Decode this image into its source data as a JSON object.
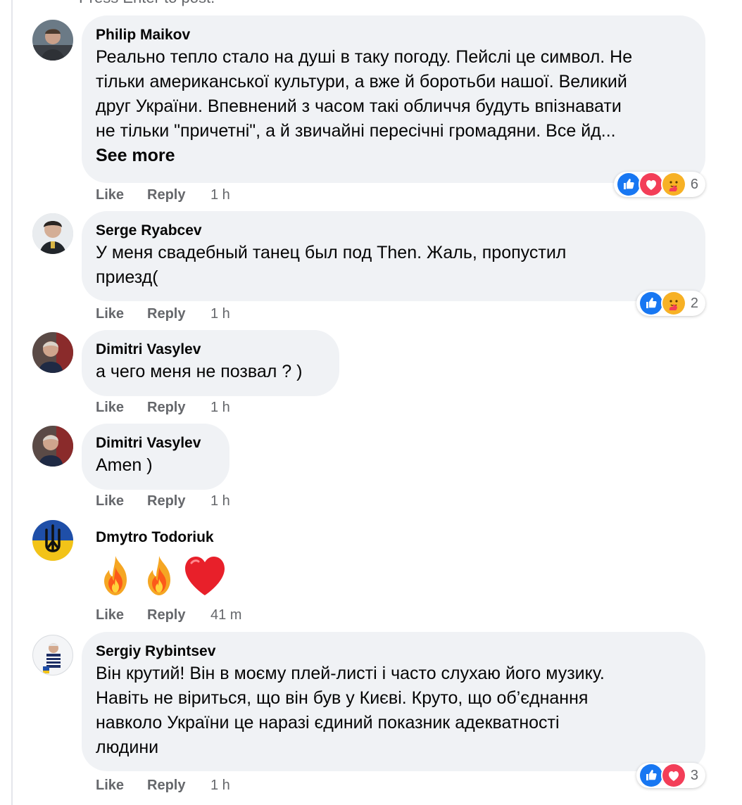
{
  "top_hint": "Press Enter to post.",
  "actions": {
    "like": "Like",
    "reply": "Reply"
  },
  "colors": {
    "like_blue": "#1877f2",
    "love_red": "#f33e58",
    "care_yellow": "#f7b125",
    "bubble_bg": "#f0f2f5",
    "meta_gray": "#65676b"
  },
  "comments": [
    {
      "author": "Philip Maikov",
      "text": "Реально тепло стало на душі в таку погоду. Пейслі це символ. Не\nтільки американської культури, а вже й боротьби нашої. Великий\nдруг України. Впевнений з часом такі обличчя будуть впізнавати\nне тільки \"причетні\", а й звичайні пересічні громадяни. Все йд...",
      "see_more": "See more",
      "time": "1 h",
      "reactions": [
        "like-icon",
        "love-icon",
        "care-icon"
      ],
      "reaction_count": "6"
    },
    {
      "author": "Serge Ryabcev",
      "text": "У меня свадебный танец был под Then. Жаль, пропустил\nприезд(",
      "time": "1 h",
      "reactions": [
        "like-icon",
        "care-icon"
      ],
      "reaction_count": "2"
    },
    {
      "author": "Dimitri Vasylev",
      "text": "а чего меня не позвал ? )",
      "time": "1 h"
    },
    {
      "author": "Dimitri Vasylev",
      "text": "Amen )",
      "time": "1 h"
    },
    {
      "author": "Dmytro Todoriuk",
      "emojis": [
        "fire-emoji",
        "fire-emoji",
        "heart-emoji"
      ],
      "time": "41 m"
    },
    {
      "author": "Sergiy Rybintsev",
      "text": "Він крутий! Він в моєму плей-листі і часто слухаю його музику.\nНавіть не віриться, що він був у Києві. Круто, що об’єднання\nнавколо України це наразі єдиний показник адекватності\nлюдини",
      "time": "1 h",
      "reactions": [
        "like-icon",
        "love-icon"
      ],
      "reaction_count": "3"
    }
  ]
}
